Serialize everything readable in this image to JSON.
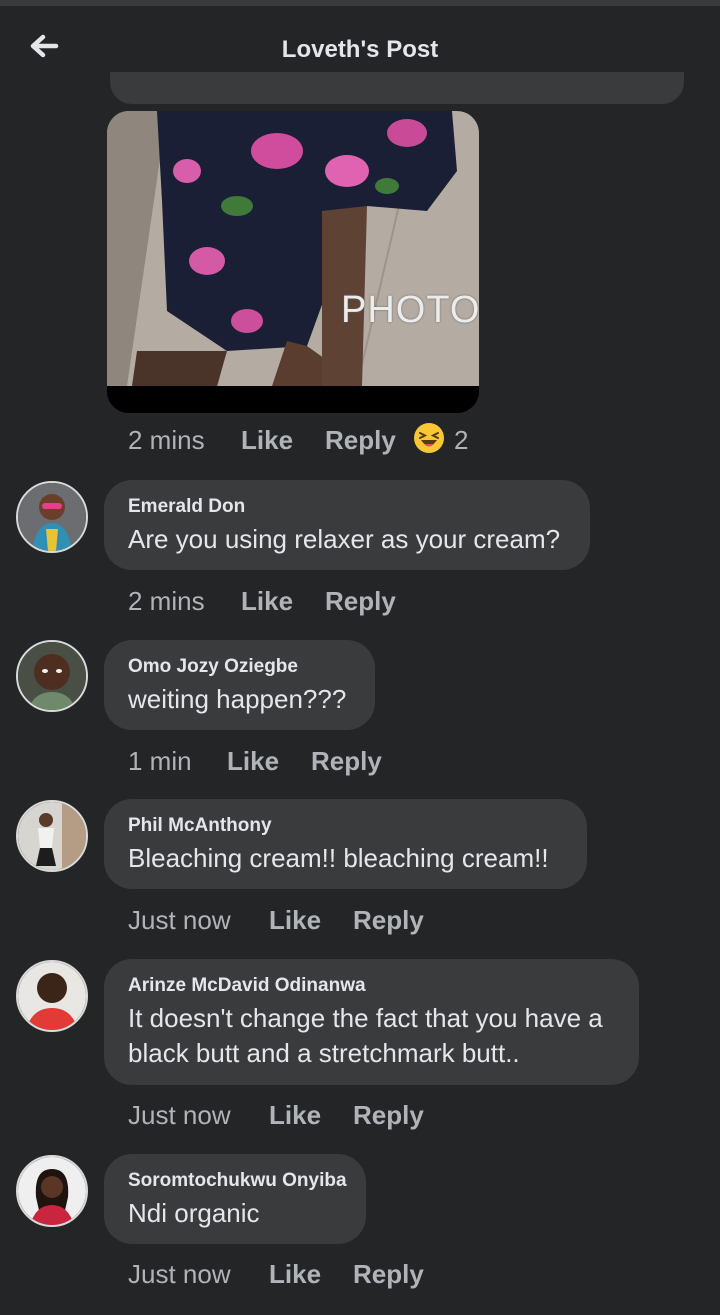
{
  "header": {
    "title": "Loveth's Post",
    "back_icon": "back-arrow-icon"
  },
  "photo": {
    "overlay_text": "PHOTO"
  },
  "actions": {
    "like": "Like",
    "reply": "Reply"
  },
  "post_meta": {
    "time": "2 mins",
    "reaction_icon": "laughing-emoji-icon",
    "reaction_count": "2"
  },
  "comments": [
    {
      "name": "Emerald Don",
      "text_lines": [
        "Are you using relaxer as your cream?"
      ],
      "time": "2 mins"
    },
    {
      "name": "Omo Jozy Oziegbe",
      "text_lines": [
        "weiting  happen???"
      ],
      "time": "1 min"
    },
    {
      "name": "Phil McAnthony",
      "text_lines": [
        "Bleaching cream!!  bleaching cream!!"
      ],
      "time": "Just now"
    },
    {
      "name": "Arinze McDavid Odinanwa",
      "text_lines": [
        "It doesn't change the fact that you have a",
        "black butt and a stretchmark butt.."
      ],
      "time": "Just now"
    },
    {
      "name": "Soromtochukwu Onyiba",
      "text_lines": [
        "Ndi organic"
      ],
      "time": "Just now"
    }
  ],
  "colors": {
    "background": "#242526",
    "bubble": "#3a3b3c",
    "text": "#e4e6eb",
    "meta": "#b0b3b8"
  }
}
